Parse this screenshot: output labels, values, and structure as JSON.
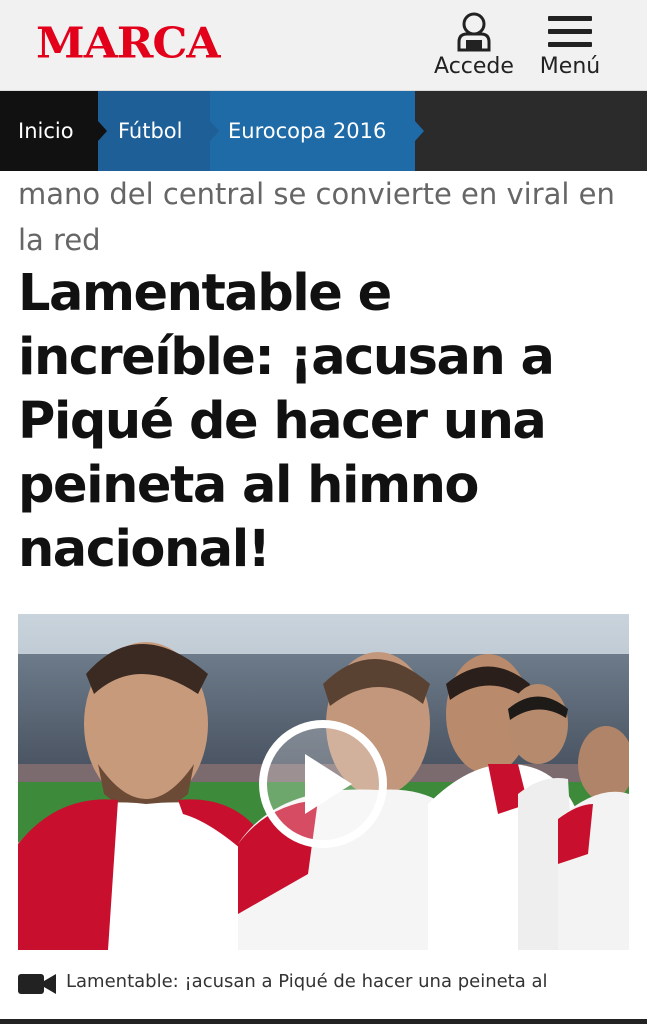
{
  "header": {
    "logo": "MARCA",
    "login_label": "Accede",
    "menu_label": "Menú",
    "logo_color": "#e3001b"
  },
  "breadcrumb": {
    "items": [
      {
        "label": "Inicio"
      },
      {
        "label": "Fútbol"
      },
      {
        "label": "Eurocopa 2016"
      }
    ]
  },
  "article": {
    "subtitle": "mano del central se convierte en viral en la red",
    "title": "Lamentable e increíble: ¡acusan a Piqué de hacer una peineta al himno nacional!",
    "video": {
      "caption": "Lamentable: ¡acusan a Piqué de hacer una peineta al",
      "play_icon": "play-icon",
      "camera_icon": "video-camera-icon"
    }
  }
}
